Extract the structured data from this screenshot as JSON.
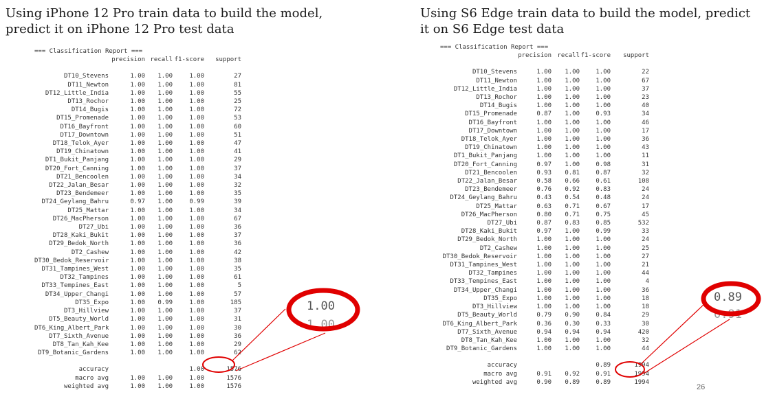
{
  "titles": {
    "left": [
      "Using iPhone 12 Pro train data to build the model,",
      "predict it on iPhone 12 Pro test data"
    ],
    "right": [
      "Using S6 Edge train data to build the model, predict",
      "it on S6 Edge test data"
    ]
  },
  "reports": {
    "left": {
      "heading": "=== Classification Report ===",
      "columns": [
        "precision",
        "recall",
        "f1-score",
        "support"
      ],
      "rows": [
        [
          "DT10_Stevens",
          "1.00",
          "1.00",
          "1.00",
          "27"
        ],
        [
          "DT11_Newton",
          "1.00",
          "1.00",
          "1.00",
          "81"
        ],
        [
          "DT12_Little_India",
          "1.00",
          "1.00",
          "1.00",
          "55"
        ],
        [
          "DT13_Rochor",
          "1.00",
          "1.00",
          "1.00",
          "25"
        ],
        [
          "DT14_Bugis",
          "1.00",
          "1.00",
          "1.00",
          "72"
        ],
        [
          "DT15_Promenade",
          "1.00",
          "1.00",
          "1.00",
          "53"
        ],
        [
          "DT16_Bayfront",
          "1.00",
          "1.00",
          "1.00",
          "60"
        ],
        [
          "DT17_Downtown",
          "1.00",
          "1.00",
          "1.00",
          "51"
        ],
        [
          "DT18_Telok_Ayer",
          "1.00",
          "1.00",
          "1.00",
          "47"
        ],
        [
          "DT19_Chinatown",
          "1.00",
          "1.00",
          "1.00",
          "41"
        ],
        [
          "DT1_Bukit_Panjang",
          "1.00",
          "1.00",
          "1.00",
          "29"
        ],
        [
          "DT20_Fort_Canning",
          "1.00",
          "1.00",
          "1.00",
          "37"
        ],
        [
          "DT21_Bencoolen",
          "1.00",
          "1.00",
          "1.00",
          "34"
        ],
        [
          "DT22_Jalan_Besar",
          "1.00",
          "1.00",
          "1.00",
          "32"
        ],
        [
          "DT23_Bendemeer",
          "1.00",
          "1.00",
          "1.00",
          "35"
        ],
        [
          "DT24_Geylang_Bahru",
          "0.97",
          "1.00",
          "0.99",
          "39"
        ],
        [
          "DT25_Mattar",
          "1.00",
          "1.00",
          "1.00",
          "34"
        ],
        [
          "DT26_MacPherson",
          "1.00",
          "1.00",
          "1.00",
          "67"
        ],
        [
          "DT27_Ubi",
          "1.00",
          "1.00",
          "1.00",
          "36"
        ],
        [
          "DT28_Kaki_Bukit",
          "1.00",
          "1.00",
          "1.00",
          "37"
        ],
        [
          "DT29_Bedok_North",
          "1.00",
          "1.00",
          "1.00",
          "36"
        ],
        [
          "DT2_Cashew",
          "1.00",
          "1.00",
          "1.00",
          "42"
        ],
        [
          "DT30_Bedok_Reservoir",
          "1.00",
          "1.00",
          "1.00",
          "38"
        ],
        [
          "DT31_Tampines_West",
          "1.00",
          "1.00",
          "1.00",
          "35"
        ],
        [
          "DT32_Tampines",
          "1.00",
          "1.00",
          "1.00",
          "61"
        ],
        [
          "DT33_Tempines_East",
          "1.00",
          "1.00",
          "1.00",
          "5"
        ],
        [
          "DT34_Upper_Changi",
          "1.00",
          "1.00",
          "1.00",
          "57"
        ],
        [
          "DT35_Expo",
          "1.00",
          "0.99",
          "1.00",
          "185"
        ],
        [
          "DT3_Hillview",
          "1.00",
          "1.00",
          "1.00",
          "37"
        ],
        [
          "DT5_Beauty_World",
          "1.00",
          "1.00",
          "1.00",
          "31"
        ],
        [
          "DT6_King_Albert_Park",
          "1.00",
          "1.00",
          "1.00",
          "30"
        ],
        [
          "DT7_Sixth_Avenue",
          "1.00",
          "1.00",
          "1.00",
          "36"
        ],
        [
          "DT8_Tan_Kah_Kee",
          "1.00",
          "1.00",
          "1.00",
          "29"
        ],
        [
          "DT9_Botanic_Gardens",
          "1.00",
          "1.00",
          "1.00",
          "62"
        ]
      ],
      "summary": [
        [
          "accuracy",
          "",
          "",
          "1.00",
          "1576"
        ],
        [
          "macro avg",
          "1.00",
          "1.00",
          "1.00",
          "1576"
        ],
        [
          "weighted avg",
          "1.00",
          "1.00",
          "1.00",
          "1576"
        ]
      ],
      "zoom_values": [
        "1.00",
        "1.00"
      ]
    },
    "right": {
      "heading": "=== Classification Report ===",
      "columns": [
        "precision",
        "recall",
        "f1-score",
        "support"
      ],
      "rows": [
        [
          "DT10_Stevens",
          "1.00",
          "1.00",
          "1.00",
          "22"
        ],
        [
          "DT11_Newton",
          "1.00",
          "1.00",
          "1.00",
          "67"
        ],
        [
          "DT12_Little_India",
          "1.00",
          "1.00",
          "1.00",
          "37"
        ],
        [
          "DT13_Rochor",
          "1.00",
          "1.00",
          "1.00",
          "23"
        ],
        [
          "DT14_Bugis",
          "1.00",
          "1.00",
          "1.00",
          "40"
        ],
        [
          "DT15_Promenade",
          "0.87",
          "1.00",
          "0.93",
          "34"
        ],
        [
          "DT16_Bayfront",
          "1.00",
          "1.00",
          "1.00",
          "46"
        ],
        [
          "DT17_Downtown",
          "1.00",
          "1.00",
          "1.00",
          "17"
        ],
        [
          "DT18_Telok_Ayer",
          "1.00",
          "1.00",
          "1.00",
          "36"
        ],
        [
          "DT19_Chinatown",
          "1.00",
          "1.00",
          "1.00",
          "43"
        ],
        [
          "DT1_Bukit_Panjang",
          "1.00",
          "1.00",
          "1.00",
          "11"
        ],
        [
          "DT20_Fort_Canning",
          "0.97",
          "1.00",
          "0.98",
          "31"
        ],
        [
          "DT21_Bencoolen",
          "0.93",
          "0.81",
          "0.87",
          "32"
        ],
        [
          "DT22_Jalan_Besar",
          "0.58",
          "0.66",
          "0.61",
          "108"
        ],
        [
          "DT23_Bendemeer",
          "0.76",
          "0.92",
          "0.83",
          "24"
        ],
        [
          "DT24_Geylang_Bahru",
          "0.43",
          "0.54",
          "0.48",
          "24"
        ],
        [
          "DT25_Mattar",
          "0.63",
          "0.71",
          "0.67",
          "17"
        ],
        [
          "DT26_MacPherson",
          "0.80",
          "0.71",
          "0.75",
          "45"
        ],
        [
          "DT27_Ubi",
          "0.87",
          "0.83",
          "0.85",
          "532"
        ],
        [
          "DT28_Kaki_Bukit",
          "0.97",
          "1.00",
          "0.99",
          "33"
        ],
        [
          "DT29_Bedok_North",
          "1.00",
          "1.00",
          "1.00",
          "24"
        ],
        [
          "DT2_Cashew",
          "1.00",
          "1.00",
          "1.00",
          "25"
        ],
        [
          "DT30_Bedok_Reservoir",
          "1.00",
          "1.00",
          "1.00",
          "27"
        ],
        [
          "DT31_Tampines_West",
          "1.00",
          "1.00",
          "1.00",
          "21"
        ],
        [
          "DT32_Tampines",
          "1.00",
          "1.00",
          "1.00",
          "44"
        ],
        [
          "DT33_Tempines_East",
          "1.00",
          "1.00",
          "1.00",
          "4"
        ],
        [
          "DT34_Upper_Changi",
          "1.00",
          "1.00",
          "1.00",
          "36"
        ],
        [
          "DT35_Expo",
          "1.00",
          "1.00",
          "1.00",
          "18"
        ],
        [
          "DT3_Hillview",
          "1.00",
          "1.00",
          "1.00",
          "18"
        ],
        [
          "DT5_Beauty_World",
          "0.79",
          "0.90",
          "0.84",
          "29"
        ],
        [
          "DT6_King_Albert_Park",
          "0.36",
          "0.30",
          "0.33",
          "30"
        ],
        [
          "DT7_Sixth_Avenue",
          "0.94",
          "0.94",
          "0.94",
          "420"
        ],
        [
          "DT8_Tan_Kah_Kee",
          "1.00",
          "1.00",
          "1.00",
          "32"
        ],
        [
          "DT9_Botanic_Gardens",
          "1.00",
          "1.00",
          "1.00",
          "44"
        ]
      ],
      "summary": [
        [
          "accuracy",
          "",
          "",
          "0.89",
          "1994"
        ],
        [
          "macro avg",
          "0.91",
          "0.92",
          "0.91",
          "1994"
        ],
        [
          "weighted avg",
          "0.90",
          "0.89",
          "0.89",
          "1994"
        ]
      ],
      "zoom_values": [
        "0.89",
        "0.91"
      ]
    }
  },
  "page_number": "26",
  "colors": {
    "highlight": "#e00000",
    "text": "#333333"
  }
}
